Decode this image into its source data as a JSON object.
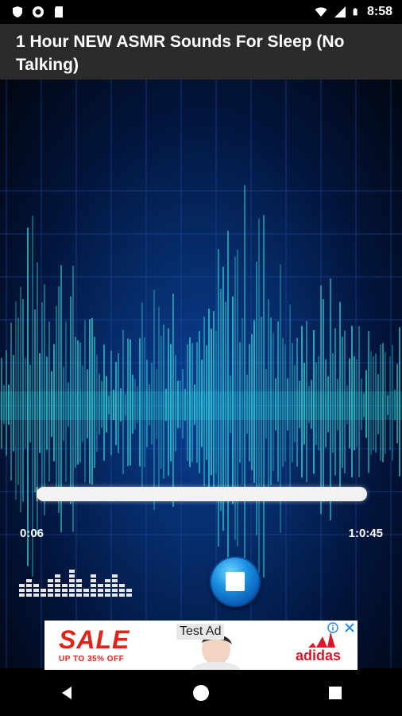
{
  "status_bar": {
    "time": "8:58",
    "icons": [
      "shield-icon",
      "record-icon",
      "sd-card-icon",
      "wifi-icon",
      "signal-icon",
      "battery-icon"
    ]
  },
  "app": {
    "title": "1 Hour NEW ASMR Sounds For Sleep (No Talking)"
  },
  "player": {
    "elapsed": "0:06",
    "duration": "1:0:45",
    "progress": 0.002,
    "control": "stop-icon",
    "equalizer_icon": "equalizer-icon"
  },
  "ad": {
    "label": "Test Ad",
    "headline": "SALE",
    "subline": "UP TO 35% OFF",
    "brand": "adidas",
    "info_icon": "info-icon",
    "close_icon": "close-icon",
    "colors": {
      "sale": "#e2231a",
      "brand": "#d6192b",
      "adchoices": "#2a8be0"
    }
  },
  "nav": {
    "back": "back-icon",
    "home": "home-icon",
    "recents": "recents-icon"
  },
  "colors": {
    "status_bar": "#000000",
    "title_bar": "#2b2b2b",
    "wave": "#2de3e0",
    "background_center": "#0a3f93"
  }
}
